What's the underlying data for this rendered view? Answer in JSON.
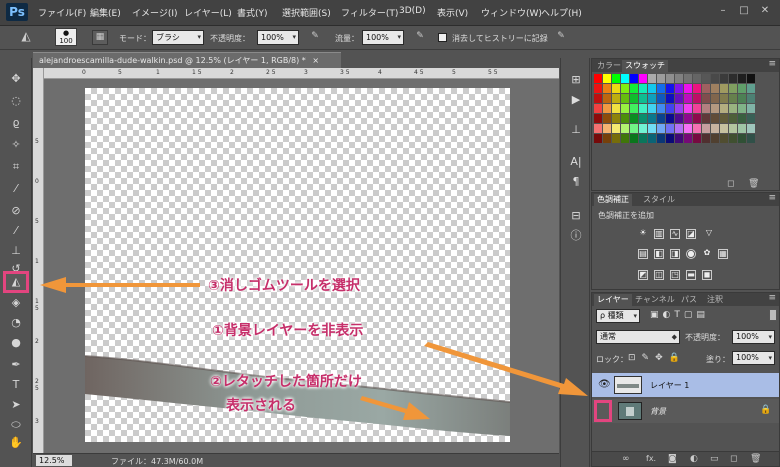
{
  "app": {
    "logo": "Ps"
  },
  "menu": [
    "ファイル(F)",
    "編集(E)",
    "イメージ(I)",
    "レイヤー(L)",
    "書式(Y)",
    "選択範囲(S)",
    "フィルター(T)",
    "3D(D)",
    "表示(V)",
    "ウィンドウ(W)",
    "ヘルプ(H)"
  ],
  "window_buttons": {
    "minimize": "–",
    "maximize": "□",
    "close": "✕"
  },
  "options": {
    "brush_size": "100",
    "mode_label": "モード：",
    "mode_value": "ブラシ",
    "opacity_label": "不透明度：",
    "opacity_value": "100%",
    "flow_label": "流量：",
    "flow_value": "100%",
    "history_label": "消去してヒストリーに記録"
  },
  "document": {
    "tab_title": "alejandroescamilla-dude-walkin.psd @ 12.5% (レイヤー 1, RGB/8) *",
    "tab_close": "×",
    "zoom": "12.5%",
    "file_size": "ファイル：47.3M/60.0M",
    "ruler_top_ticks": [
      "0",
      "5",
      "1",
      "1 5",
      "2",
      "2 5",
      "3",
      "3 5",
      "4",
      "4 5",
      "5",
      "5 5"
    ],
    "ruler_left_ticks": [
      "5",
      "0",
      "5",
      "1",
      "1 5",
      "2",
      "2 5",
      "3"
    ]
  },
  "color_panel": {
    "tabs": [
      "カラー",
      "スウォッチ"
    ],
    "active_tab": 1
  },
  "adjust_panel": {
    "tabs": [
      "色調補正",
      "スタイル"
    ],
    "active_tab": 0,
    "title": "色調補正を追加"
  },
  "layers_panel": {
    "tabs": [
      "レイヤー",
      "チャンネル",
      "パス",
      "注釈"
    ],
    "active_tab": 0,
    "filter_label": "ρ 種類",
    "blend_mode": "通常",
    "opacity_label": "不透明度：",
    "opacity_value": "100%",
    "lock_label": "ロック：",
    "fill_label": "塗り：",
    "fill_value": "100%",
    "layers": [
      {
        "name": "レイヤー 1",
        "visible": true,
        "selected": true
      },
      {
        "name": "背景",
        "visible": false,
        "selected": false
      }
    ],
    "footer_icons": [
      "link-icon",
      "fx-icon",
      "mask-icon",
      "adjustment-icon",
      "folder-icon",
      "new-layer-icon",
      "trash-icon"
    ],
    "footer_fx": "fx."
  },
  "annotations": {
    "step3": "③消しゴムツールを選択",
    "step1": "①背景レイヤーを非表示",
    "step2_line1": "②レタッチした箇所だけ",
    "step2_line2": "表示される"
  },
  "colors": {
    "annotation": "#c62f6a",
    "highlight": "#e2457f",
    "arrow": "#f0963a",
    "layer_selected": "#a9bde6"
  }
}
